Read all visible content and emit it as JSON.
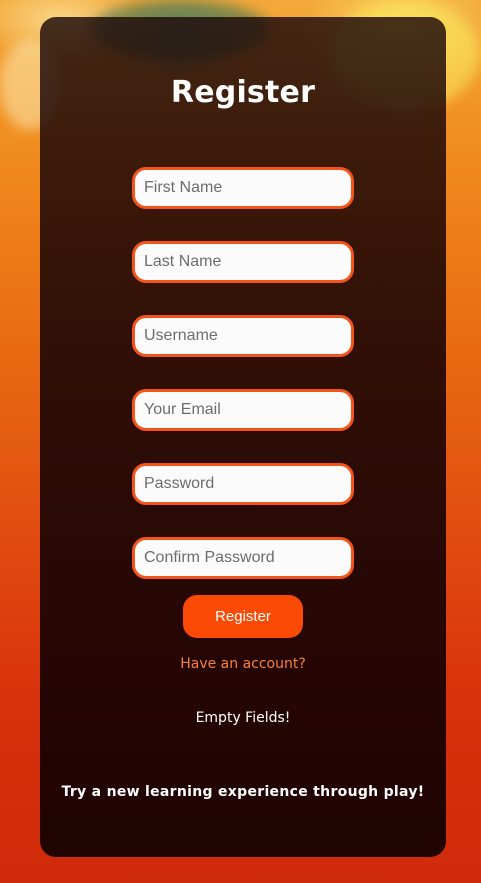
{
  "form": {
    "title": "Register",
    "fields": [
      {
        "placeholder": "First Name",
        "value": ""
      },
      {
        "placeholder": "Last Name",
        "value": ""
      },
      {
        "placeholder": "Username",
        "value": ""
      },
      {
        "placeholder": "Your Email",
        "value": ""
      },
      {
        "placeholder": "Password",
        "value": ""
      },
      {
        "placeholder": "Confirm Password",
        "value": ""
      }
    ],
    "submit_label": "Register",
    "account_link": "Have an account?",
    "status_message": "Empty Fields!",
    "tagline": "Try a new learning experience through play!"
  },
  "colors": {
    "accent": "#fa4a06",
    "field_border": "#f2541c",
    "link": "#f5813d",
    "panel": "#1a0404"
  }
}
